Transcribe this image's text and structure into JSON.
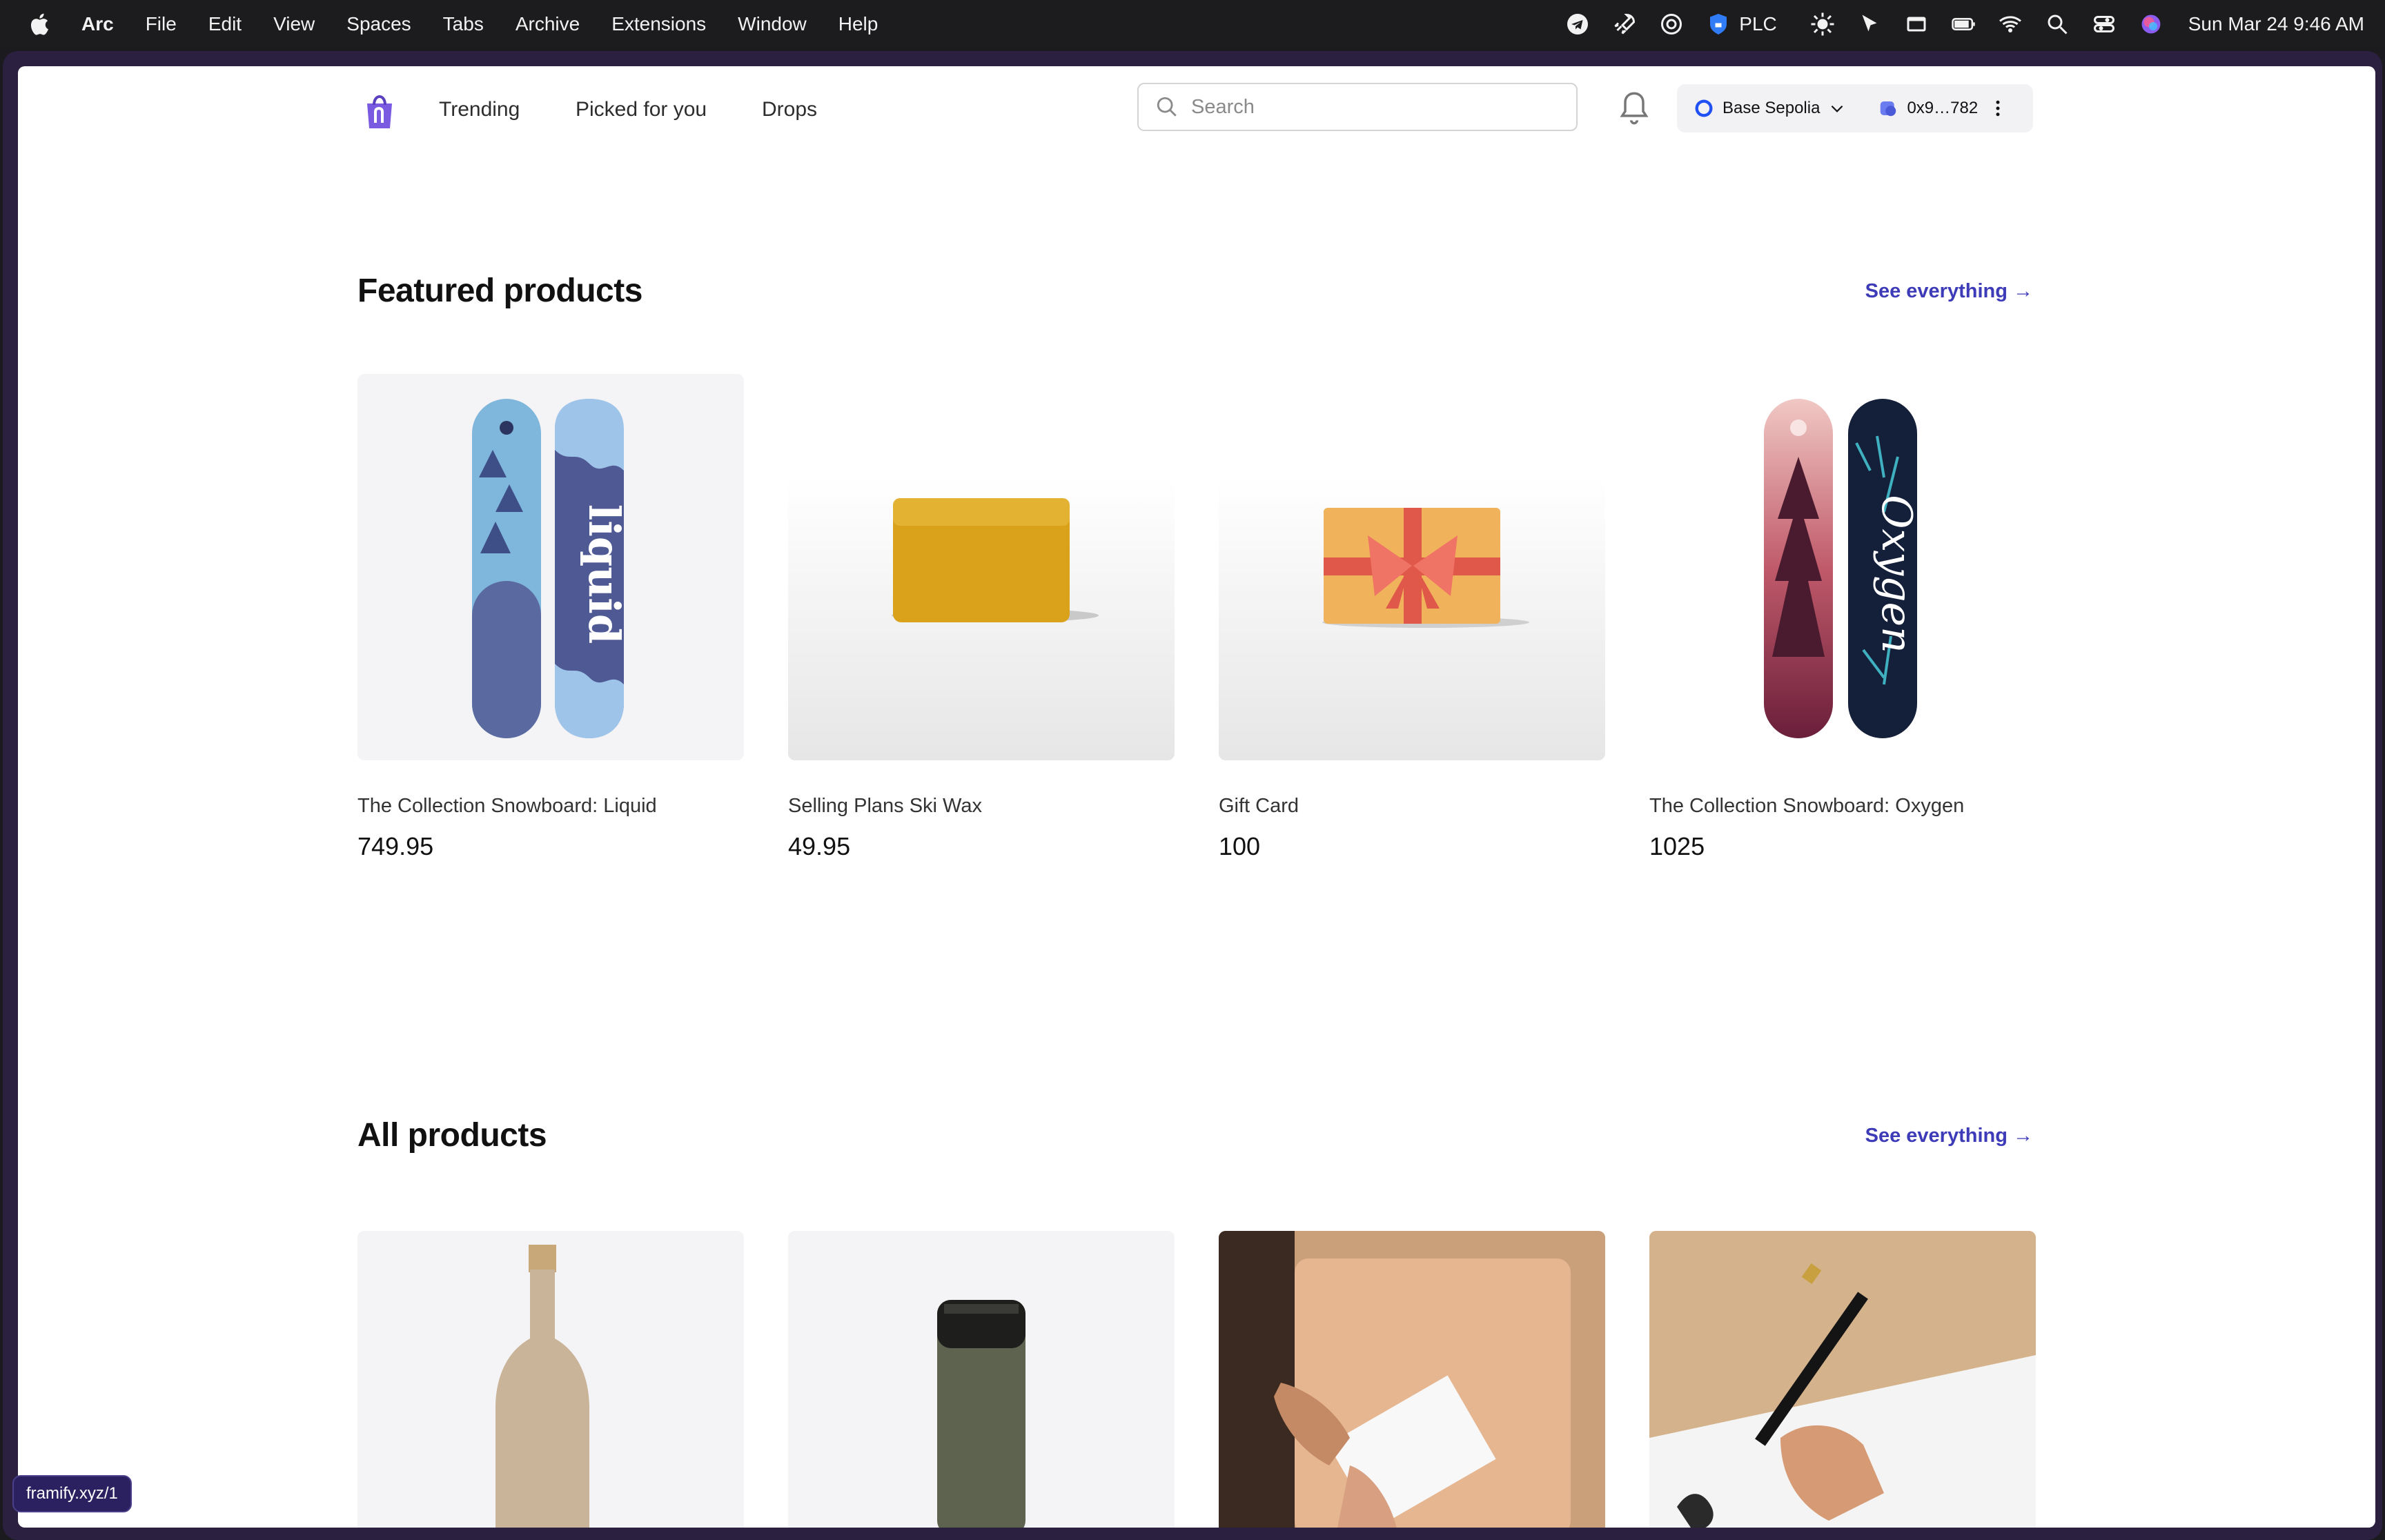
{
  "menubar": {
    "app": "Arc",
    "items": [
      "File",
      "Edit",
      "View",
      "Spaces",
      "Tabs",
      "Archive",
      "Extensions",
      "Window",
      "Help"
    ],
    "status_text": "PLC",
    "datetime": "Sun Mar 24  9:46 AM"
  },
  "header": {
    "nav": [
      "Trending",
      "Picked for you",
      "Drops"
    ],
    "search_placeholder": "Search",
    "network": "Base Sepolia",
    "account": "0x9…782"
  },
  "featured": {
    "title": "Featured products",
    "see_all": "See everything →",
    "products": [
      {
        "name": "The Collection Snowboard: Liquid",
        "price": "749.95"
      },
      {
        "name": "Selling Plans Ski Wax",
        "price": "49.95"
      },
      {
        "name": "Gift Card",
        "price": "100"
      },
      {
        "name": "The Collection Snowboard: Oxygen",
        "price": "1025"
      }
    ]
  },
  "all_products": {
    "title": "All products",
    "see_all": "See everything →"
  },
  "status_url": "framify.xyz/1",
  "colors": {
    "accent": "#3d3bb8",
    "page_bg": "#ffffff",
    "frame": "#2b2040"
  }
}
